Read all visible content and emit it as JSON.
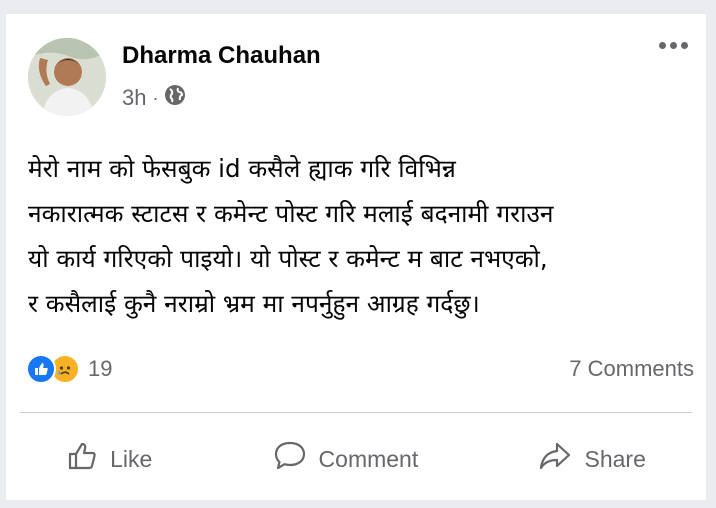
{
  "post": {
    "author": "Dharma Chauhan",
    "time": "3h",
    "separator": "·",
    "privacy_icon": "globe-icon",
    "text_lines": [
      "मेरो नाम को फेसबुक id कसैले ह्याक गरि विभिन्न",
      "नकारात्मक स्टाटस र कमेन्ट पोस्ट गरि मलाई बदनामी गराउन",
      "यो कार्य गरिएको पाइयो। यो पोस्ट र कमेन्ट म बाट नभएको,",
      "र कसैलाई कुनै नराम्रो भ्रम मा नपर्नुहुन आग्रह गर्दछु।"
    ]
  },
  "stats": {
    "reaction_icons": [
      "like-reaction-icon",
      "sad-reaction-icon"
    ],
    "reaction_count": "19",
    "comments": "7 Comments"
  },
  "actions": {
    "like": "Like",
    "comment": "Comment",
    "share": "Share"
  },
  "colors": {
    "text": "#050505",
    "secondary_text": "#65676b",
    "like_blue": "#1877f2",
    "sad_yellow": "#f7b125",
    "background": "#e9ebee"
  }
}
